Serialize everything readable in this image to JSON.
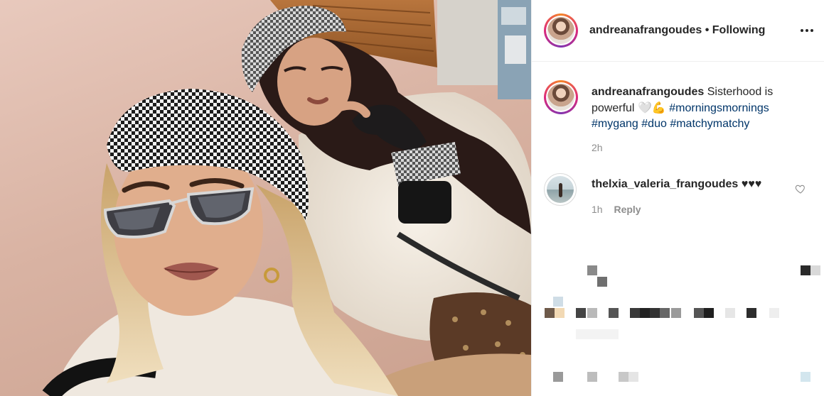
{
  "post": {
    "username": "andreanafrangoudes",
    "separator": "•",
    "follow_state": "Following"
  },
  "caption": {
    "username": "andreanafrangoudes",
    "text": "Sisterhood is powerful",
    "emoji": "🤍💪",
    "hashtags": [
      "#morningsmornings",
      "#mygang",
      "#duo",
      "#matchymatchy"
    ],
    "time": "2h"
  },
  "comment": {
    "username": "thelxia_valeria_frangoudes",
    "text": "♥♥♥",
    "time": "1h",
    "reply_label": "Reply"
  },
  "icons": {
    "more": "more-options-icon",
    "like": "heart-icon"
  },
  "colors": {
    "hashtag": "#003569",
    "muted": "#8e8e8e",
    "text": "#262626",
    "border": "#efefef"
  }
}
